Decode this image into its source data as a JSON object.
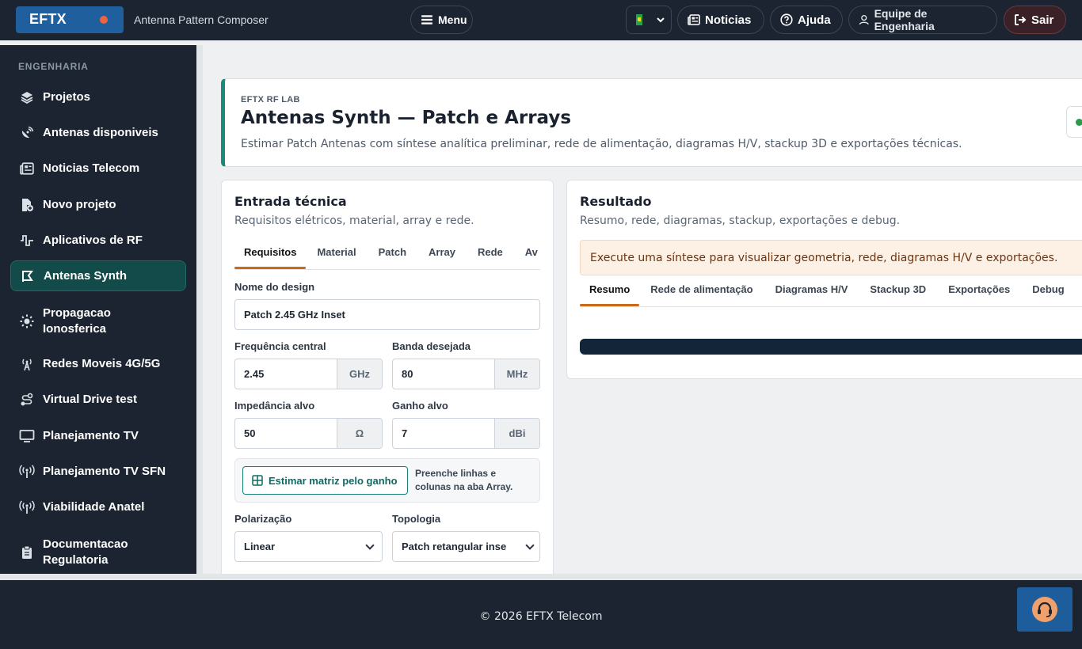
{
  "topbar": {
    "brand": "EFTX",
    "app_subtitle": "Antenna Pattern Composer",
    "menu_label": "Menu",
    "language_flag": "flag-brazil-icon",
    "news_label": "Noticias",
    "help_label": "Ajuda",
    "team_label": "Equipe de Engenharia",
    "exit_label": "Sair"
  },
  "sidebar": {
    "section_label": "ENGENHARIA",
    "items": [
      {
        "label": "Projetos",
        "icon": "layers-icon"
      },
      {
        "label": "Antenas disponiveis",
        "icon": "satellite-dish-icon"
      },
      {
        "label": "Noticias Telecom",
        "icon": "newspaper-icon"
      },
      {
        "label": "Novo projeto",
        "icon": "new-file-icon"
      },
      {
        "label": "Aplicativos de RF",
        "icon": "signal-wave-icon"
      },
      {
        "label": "Antenas Synth",
        "icon": "synth-icon"
      },
      {
        "label": "Propagacao Ionosferica",
        "icon": "sun-icon"
      },
      {
        "label": "Redes Moveis 4G/5G",
        "icon": "tower-icon"
      },
      {
        "label": "Virtual Drive test",
        "icon": "route-icon"
      },
      {
        "label": "Planejamento TV",
        "icon": "monitor-icon"
      },
      {
        "label": "Planejamento TV SFN",
        "icon": "broadcast-icon"
      },
      {
        "label": "Viabilidade Anatel",
        "icon": "broadcast-icon"
      },
      {
        "label": "Documentacao Regulatoria",
        "icon": "clipboard-icon"
      }
    ],
    "active_item": "Antenas Synth"
  },
  "hero": {
    "kicker": "EFTX RF LAB",
    "title": "Antenas Synth — Patch e Arrays",
    "description": "Estimar Patch Antenas com síntese analítica preliminar, rede de alimentação, diagramas H/V, stackup 3D e exportações técnicas."
  },
  "input_card": {
    "title": "Entrada técnica",
    "subtitle": "Requisitos elétricos, material, array e rede.",
    "tabs": [
      "Requisitos",
      "Material",
      "Patch",
      "Array",
      "Rede",
      "Av"
    ],
    "active_tab": "Requisitos",
    "fields": {
      "design_name": {
        "label": "Nome do design",
        "value": "Patch 2.45 GHz Inset"
      },
      "center_freq": {
        "label": "Frequência central",
        "value": "2.45",
        "unit": "GHz"
      },
      "bandwidth": {
        "label": "Banda desejada",
        "value": "80",
        "unit": "MHz"
      },
      "impedance": {
        "label": "Impedância alvo",
        "value": "50",
        "unit": "Ω"
      },
      "gain": {
        "label": "Ganho alvo",
        "value": "7",
        "unit": "dBi"
      },
      "polarization": {
        "label": "Polarização",
        "value": "Linear"
      },
      "topology": {
        "label": "Topologia",
        "value": "Patch retangular inse"
      }
    },
    "estimate_button": "Estimar matriz pelo ganho",
    "estimate_note": "Preenche linhas e colunas na aba Array."
  },
  "result_card": {
    "title": "Resultado",
    "subtitle": "Resumo, rede, diagramas, stackup, exportações e debug.",
    "alert": "Execute uma síntese para visualizar geometria, rede, diagramas H/V e exportações.",
    "tabs": [
      "Resumo",
      "Rede de alimentação",
      "Diagramas H/V",
      "Stackup 3D",
      "Exportações",
      "Debug"
    ],
    "active_tab": "Resumo"
  },
  "footer": {
    "copyright": "© 2026 EFTX Telecom",
    "support_icon": "headset-icon"
  },
  "colors": {
    "navbar": "#1b2430",
    "accent_teal": "#1a8b7a",
    "active_tab_underline": "#c76a1c",
    "brand_blue": "#1f5f9e",
    "alert_bg": "#fdf1e6"
  }
}
